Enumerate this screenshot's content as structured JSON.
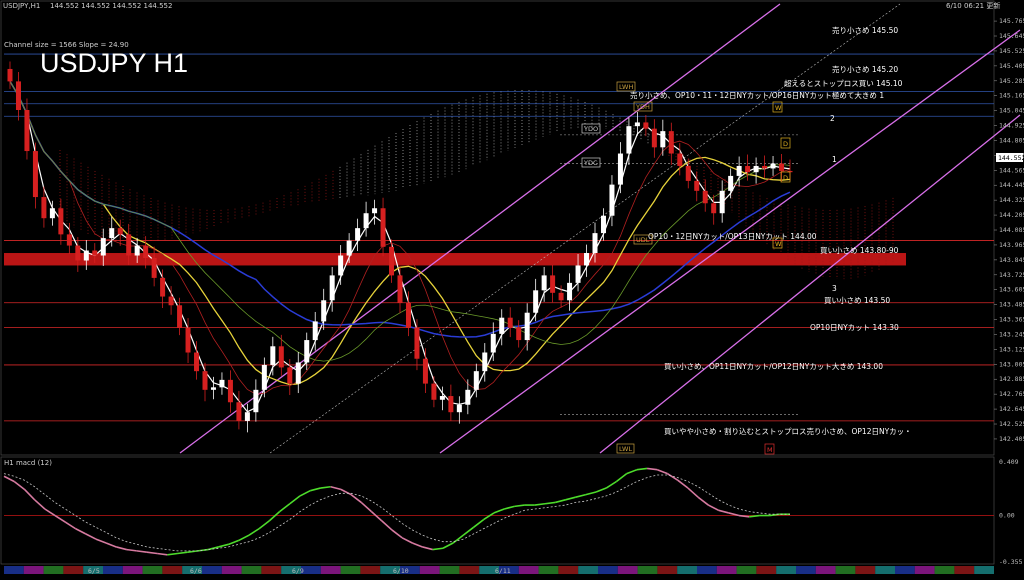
{
  "header": {
    "instrument": "USDJPY,H1",
    "ohlc": "144.552 144.552 144.552 144.552",
    "indicator": "Channel size = 1566 Slope = 24.90",
    "clock": "6/10 06:21 更新",
    "title": "USDJPY H1"
  },
  "colors": {
    "bg": "#000000",
    "grid": "#333333",
    "up": "#ffffff",
    "down": "#d62020",
    "channel": "#d76fe8",
    "level_line": "#ff3030",
    "zone": "#c41616",
    "macd_line": "#4ddc2b",
    "macd_signal": "#c9c9c9"
  },
  "chart_data": [
    {
      "type": "candlestick",
      "title": "USDJPY H1",
      "ylim": [
        142.3,
        145.85
      ],
      "y_ticks": [
        "145.765",
        "145.645",
        "145.525",
        "145.405",
        "145.285",
        "145.165",
        "145.045",
        "144.925",
        "144.805",
        "144.685",
        "144.565",
        "144.445",
        "144.325",
        "144.205",
        "144.085",
        "143.965",
        "143.845",
        "143.725",
        "143.605",
        "143.485",
        "143.365",
        "143.245",
        "143.125",
        "143.005",
        "142.885",
        "142.765",
        "142.645",
        "142.525",
        "142.405",
        "142.285"
      ],
      "x_ticks": [
        "6/5",
        "6/6",
        "6/9",
        "6/10",
        "6/11"
      ],
      "current_price": "144.552",
      "close_series": [
        145.28,
        145.05,
        144.72,
        144.35,
        144.18,
        144.26,
        144.05,
        143.96,
        143.84,
        143.92,
        143.88,
        144.02,
        144.1,
        144.05,
        143.88,
        143.96,
        143.86,
        143.7,
        143.55,
        143.48,
        143.3,
        143.1,
        142.95,
        142.8,
        142.82,
        142.88,
        142.7,
        142.55,
        142.62,
        142.8,
        143.0,
        143.15,
        142.98,
        142.85,
        143.02,
        143.2,
        143.35,
        143.52,
        143.72,
        143.88,
        144.0,
        144.1,
        144.22,
        144.26,
        143.95,
        143.72,
        143.5,
        143.3,
        143.05,
        142.85,
        142.72,
        142.75,
        142.62,
        142.68,
        142.8,
        142.95,
        143.1,
        143.25,
        143.38,
        143.3,
        143.2,
        143.42,
        143.6,
        143.72,
        143.58,
        143.52,
        143.66,
        143.8,
        143.9,
        144.06,
        144.2,
        144.45,
        144.7,
        144.92,
        144.95,
        144.9,
        144.75,
        144.88,
        144.7,
        144.6,
        144.48,
        144.4,
        144.3,
        144.22,
        144.4,
        144.52,
        144.6,
        144.55,
        144.6,
        144.58,
        144.62,
        144.56,
        144.55
      ],
      "levels": [
        {
          "price": 145.5,
          "label": "売り小さめ 145.50"
        },
        {
          "price": 145.2,
          "label": "売り小さめ 145.20"
        },
        {
          "price": 145.1,
          "label": "超えるとストップロス買い 145.10"
        },
        {
          "price": 145.0,
          "label": "売り小さめ、OP10・11・12日NYカット/OP16日NYカット極めて大きめ 1"
        },
        {
          "price": 144.0,
          "label": "OP10・12日NYカット/OP13日NYカット 144.00"
        },
        {
          "price": 143.5,
          "label": "買い小さめ 143.50"
        },
        {
          "price": 143.3,
          "label": "OP10日NYカット 143.30"
        },
        {
          "price": 143.0,
          "label": "買い小さめ、OP11日NYカット/OP12日NYカット大きめ 143.00"
        },
        {
          "price": 142.55,
          "label": "買いやや小さめ・割り込むとストップロス売り小さめ、OP12日NYカッ・"
        }
      ],
      "zone": {
        "from": 143.8,
        "to": 143.9,
        "label": "買い小さめ 143.80-90"
      },
      "tags": [
        "LWH",
        "YDH",
        "YDO",
        "YDC",
        "UDL",
        "LWL",
        "D",
        "W",
        "D",
        "W",
        "M"
      ],
      "wave_labels": [
        "1",
        "2",
        "3"
      ]
    },
    {
      "type": "line",
      "title": "H1 macd (12)",
      "ylim": [
        -0.355,
        0.409
      ],
      "y_ticks": [
        "0.409",
        "0.00",
        "-0.355"
      ],
      "series": [
        {
          "name": "macd",
          "values": [
            0.3,
            0.26,
            0.2,
            0.12,
            0.05,
            0.0,
            -0.05,
            -0.1,
            -0.14,
            -0.18,
            -0.21,
            -0.24,
            -0.26,
            -0.27,
            -0.28,
            -0.29,
            -0.3,
            -0.29,
            -0.28,
            -0.27,
            -0.26,
            -0.24,
            -0.22,
            -0.19,
            -0.15,
            -0.1,
            -0.04,
            0.03,
            0.09,
            0.15,
            0.19,
            0.21,
            0.22,
            0.2,
            0.16,
            0.1,
            0.03,
            -0.04,
            -0.11,
            -0.17,
            -0.21,
            -0.24,
            -0.26,
            -0.25,
            -0.21,
            -0.15,
            -0.09,
            -0.03,
            0.02,
            0.05,
            0.07,
            0.08,
            0.08,
            0.09,
            0.1,
            0.12,
            0.14,
            0.16,
            0.18,
            0.21,
            0.26,
            0.32,
            0.35,
            0.36,
            0.35,
            0.32,
            0.27,
            0.21,
            0.14,
            0.08,
            0.04,
            0.02,
            0.0,
            -0.01,
            0.0,
            0.0,
            0.01,
            0.01
          ]
        },
        {
          "name": "signal",
          "values": [
            0.32,
            0.3,
            0.27,
            0.22,
            0.16,
            0.1,
            0.05,
            0.0,
            -0.05,
            -0.09,
            -0.13,
            -0.17,
            -0.2,
            -0.22,
            -0.24,
            -0.25,
            -0.26,
            -0.27,
            -0.27,
            -0.27,
            -0.26,
            -0.25,
            -0.24,
            -0.22,
            -0.2,
            -0.17,
            -0.13,
            -0.08,
            -0.03,
            0.03,
            0.08,
            0.12,
            0.15,
            0.17,
            0.17,
            0.15,
            0.11,
            0.06,
            0.0,
            -0.06,
            -0.11,
            -0.15,
            -0.18,
            -0.2,
            -0.2,
            -0.18,
            -0.14,
            -0.1,
            -0.06,
            -0.02,
            0.01,
            0.04,
            0.05,
            0.06,
            0.07,
            0.08,
            0.1,
            0.11,
            0.13,
            0.15,
            0.18,
            0.22,
            0.26,
            0.29,
            0.31,
            0.31,
            0.29,
            0.26,
            0.22,
            0.17,
            0.12,
            0.08,
            0.05,
            0.03,
            0.02,
            0.01,
            0.01,
            0.01
          ]
        }
      ]
    }
  ]
}
